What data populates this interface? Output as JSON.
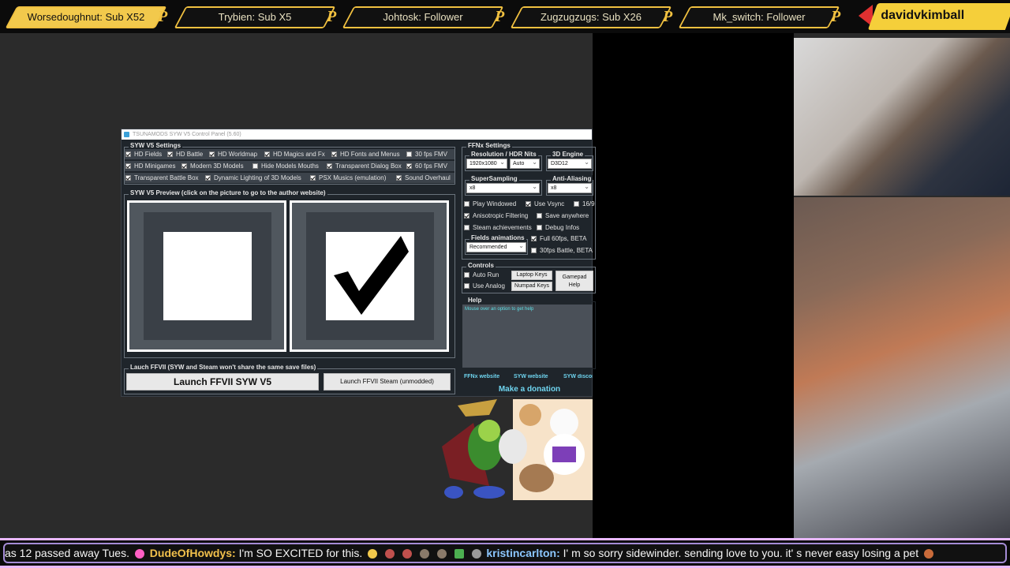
{
  "top_events": [
    {
      "text": "Worsedoughnut: Sub X52",
      "highlight": true
    },
    {
      "text": "Trybien: Sub X5",
      "highlight": false
    },
    {
      "text": "Johtosk: Follower",
      "highlight": false
    },
    {
      "text": "Zugzugzugs: Sub X26",
      "highlight": false
    },
    {
      "text": "Mk_switch: Follower",
      "highlight": false
    }
  ],
  "streamer_name": "davidvkimball",
  "app": {
    "title": "TSUNAMODS SYW V5 Control Panel (5.60)",
    "syw_settings": {
      "label": "SYW V5 Settings",
      "options": [
        {
          "label": "HD Fields",
          "checked": true
        },
        {
          "label": "HD Battle",
          "checked": true
        },
        {
          "label": "HD Worldmap",
          "checked": true
        },
        {
          "label": "HD Magics and Fx",
          "checked": true
        },
        {
          "label": "HD Fonts and Menus",
          "checked": true
        },
        {
          "label": "30 fps FMV",
          "checked": false
        },
        {
          "label": "HD Minigames",
          "checked": true
        },
        {
          "label": "Modern 3D Models",
          "checked": true
        },
        {
          "label": "Hide Models Mouths",
          "checked": false
        },
        {
          "label": "Transparent Dialog Box",
          "checked": true
        },
        {
          "label": "60 fps FMV",
          "checked": true
        },
        {
          "label": "Transparent Battle Box",
          "checked": true
        },
        {
          "label": "Dynamic Lighting of 3D Models",
          "checked": true
        },
        {
          "label": "PSX Musics (emulation)",
          "checked": true
        },
        {
          "label": "Sound Overhaul",
          "checked": true
        }
      ]
    },
    "preview": {
      "label": "SYW V5 Preview (click on the picture to go to the author website)"
    },
    "launch": {
      "label": "Lauch FFVII (SYW and Steam won't share the same save files)",
      "main_button": "Launch FFVII SYW V5",
      "steam_button": "Launch FFVII Steam (unmodded)"
    },
    "ffnx": {
      "label": "FFNx Settings",
      "resolution_label": "Resolution / HDR Nits",
      "resolution_value": "1920x1080",
      "hdr_value": "Auto",
      "engine_label": "3D Engine",
      "engine_value": "D3D12",
      "supersampling_label": "SuperSampling",
      "supersampling_value": "x8",
      "antialiasing_label": "Anti-Aliasing",
      "antialiasing_value": "x8",
      "checks": [
        {
          "label": "Play Windowed",
          "checked": false
        },
        {
          "label": "Use Vsync",
          "checked": true
        },
        {
          "label": "16/9",
          "checked": false
        },
        {
          "label": "Anisotropic Filtering",
          "checked": true
        },
        {
          "label": "Save anywhere",
          "checked": false
        },
        {
          "label": "Steam achievements",
          "checked": false
        },
        {
          "label": "Debug Infos",
          "checked": false
        }
      ],
      "fields_anim_label": "Fields animations",
      "fields_anim_value": "Recommended",
      "anim_checks": [
        {
          "label": "Full 60fps, BETA",
          "checked": true
        },
        {
          "label": "30fps Battle, BETA",
          "checked": false
        }
      ]
    },
    "controls": {
      "label": "Controls",
      "auto_run": "Auto Run",
      "use_analog": "Use Analog",
      "laptop_keys": "Laptop Keys",
      "numpad_keys": "Numpad Keys",
      "gamepad_help": "Gamepad Help"
    },
    "help": {
      "label": "Help",
      "text": "Mouse over an option to get help"
    },
    "links": {
      "ffnx": "FFNx website",
      "syw": "SYW website",
      "discord": "SYW discor"
    },
    "donate": "Make a donation"
  },
  "chat": {
    "segment1": "as 12 passed away Tues.",
    "user1": "DudeOfHowdys:",
    "msg1": "I'm SO EXCITED for this.",
    "user2": "kristincarlton:",
    "msg2": "I'   m so sorry sidewinder. sending love to you. it'   s never easy losing a pet"
  }
}
